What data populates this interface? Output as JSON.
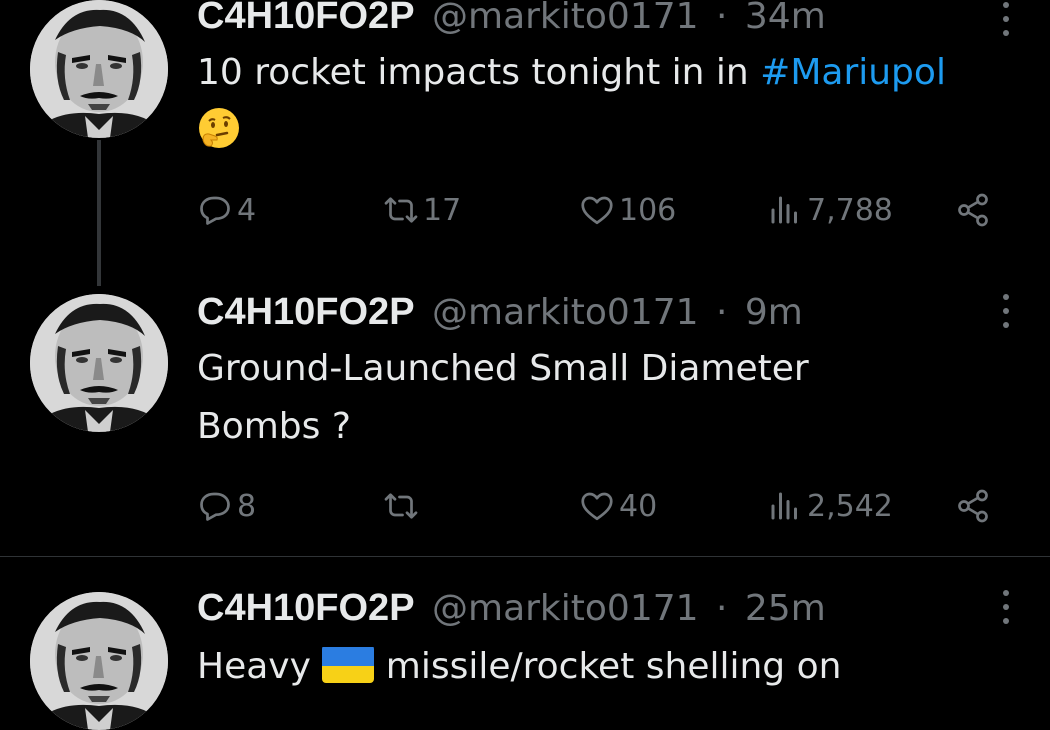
{
  "tweets": [
    {
      "name": "C4H10FO2P",
      "handle": "@markito0171",
      "separator": "·",
      "time": "34m",
      "text": "10 rocket impacts tonight in in ",
      "hashtag": "#Mariupol",
      "emoji": "thinking-face",
      "replies": "4",
      "retweets": "17",
      "likes": "106",
      "views": "7,788"
    },
    {
      "name": "C4H10FO2P",
      "handle": "@markito0171",
      "separator": "·",
      "time": "9m",
      "text_line1": "Ground-Launched Small Diameter",
      "text_line2": "Bombs ?",
      "replies": "8",
      "retweets": "",
      "likes": "40",
      "views": "2,542"
    },
    {
      "name": "C4H10FO2P",
      "handle": "@markito0171",
      "separator": "·",
      "time": "25m",
      "text_before": "Heavy ",
      "emoji": "ukraine-flag",
      "text_after": " missile/rocket shelling on"
    }
  ],
  "colors": {
    "background": "#000000",
    "text": "#e7e9ea",
    "secondary": "#71767b",
    "link": "#1d9bf0",
    "divider": "#2f3336"
  },
  "icons": [
    "reply-icon",
    "retweet-icon",
    "like-icon",
    "views-icon",
    "share-icon",
    "more-icon"
  ]
}
